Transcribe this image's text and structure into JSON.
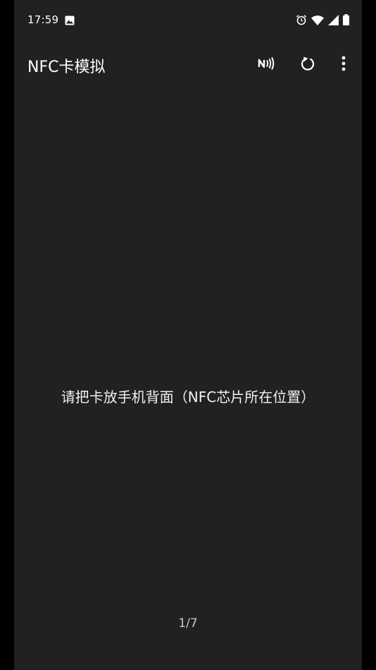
{
  "status_bar": {
    "time": "17:59",
    "left_icons": [
      "image-icon"
    ],
    "right_icons": [
      "alarm-icon",
      "wifi-icon",
      "cell-signal-icon",
      "battery-icon"
    ]
  },
  "app_bar": {
    "title": "NFC卡模拟",
    "actions": [
      "nfc-icon",
      "refresh-icon",
      "more-vert-icon"
    ]
  },
  "main": {
    "instruction": "请把卡放手机背面（NFC芯片所在位置）",
    "page_indicator": "1/7"
  },
  "colors": {
    "background": "#212121",
    "outer": "#000000",
    "text": "#ffffff",
    "secondary_text": "#c8c8c8"
  }
}
